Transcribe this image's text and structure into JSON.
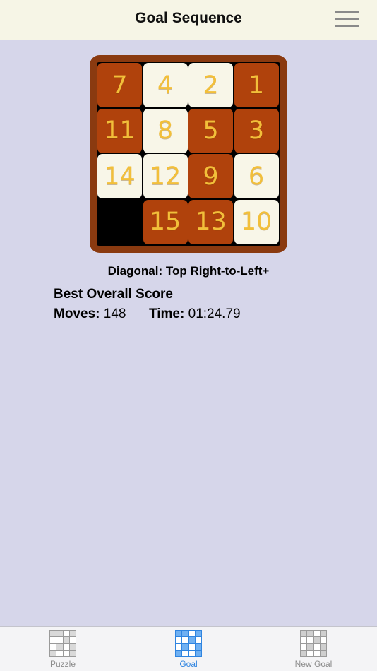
{
  "header": {
    "title": "Goal Sequence"
  },
  "board": {
    "tiles": [
      {
        "n": "7",
        "c": "brown"
      },
      {
        "n": "4",
        "c": "cream"
      },
      {
        "n": "2",
        "c": "cream"
      },
      {
        "n": "1",
        "c": "brown"
      },
      {
        "n": "11",
        "c": "brown"
      },
      {
        "n": "8",
        "c": "cream"
      },
      {
        "n": "5",
        "c": "brown"
      },
      {
        "n": "3",
        "c": "brown"
      },
      {
        "n": "14",
        "c": "cream"
      },
      {
        "n": "12",
        "c": "cream"
      },
      {
        "n": "9",
        "c": "brown"
      },
      {
        "n": "6",
        "c": "cream"
      },
      {
        "n": "",
        "c": "blank"
      },
      {
        "n": "15",
        "c": "brown"
      },
      {
        "n": "13",
        "c": "brown"
      },
      {
        "n": "10",
        "c": "cream"
      }
    ],
    "colors": {
      "frame": "#8a3a10",
      "brown_tile": "#b0420c",
      "cream_tile": "#f8f6e8",
      "digit": "#f2bf3a"
    }
  },
  "goal": {
    "name": "Diagonal: Top Right-to-Left+"
  },
  "score": {
    "title": "Best Overall Score",
    "moves_label": "Moves:",
    "moves_value": "148",
    "time_label": "Time:",
    "time_value": "01:24.79"
  },
  "tabbar": {
    "tabs": [
      {
        "label": "Puzzle",
        "icon": "puzzle-grid-icon",
        "active": false
      },
      {
        "label": "Goal",
        "icon": "goal-grid-icon",
        "active": true
      },
      {
        "label": "New Goal",
        "icon": "new-goal-grid-icon",
        "active": false
      }
    ],
    "active_color": "#2f84e0"
  }
}
